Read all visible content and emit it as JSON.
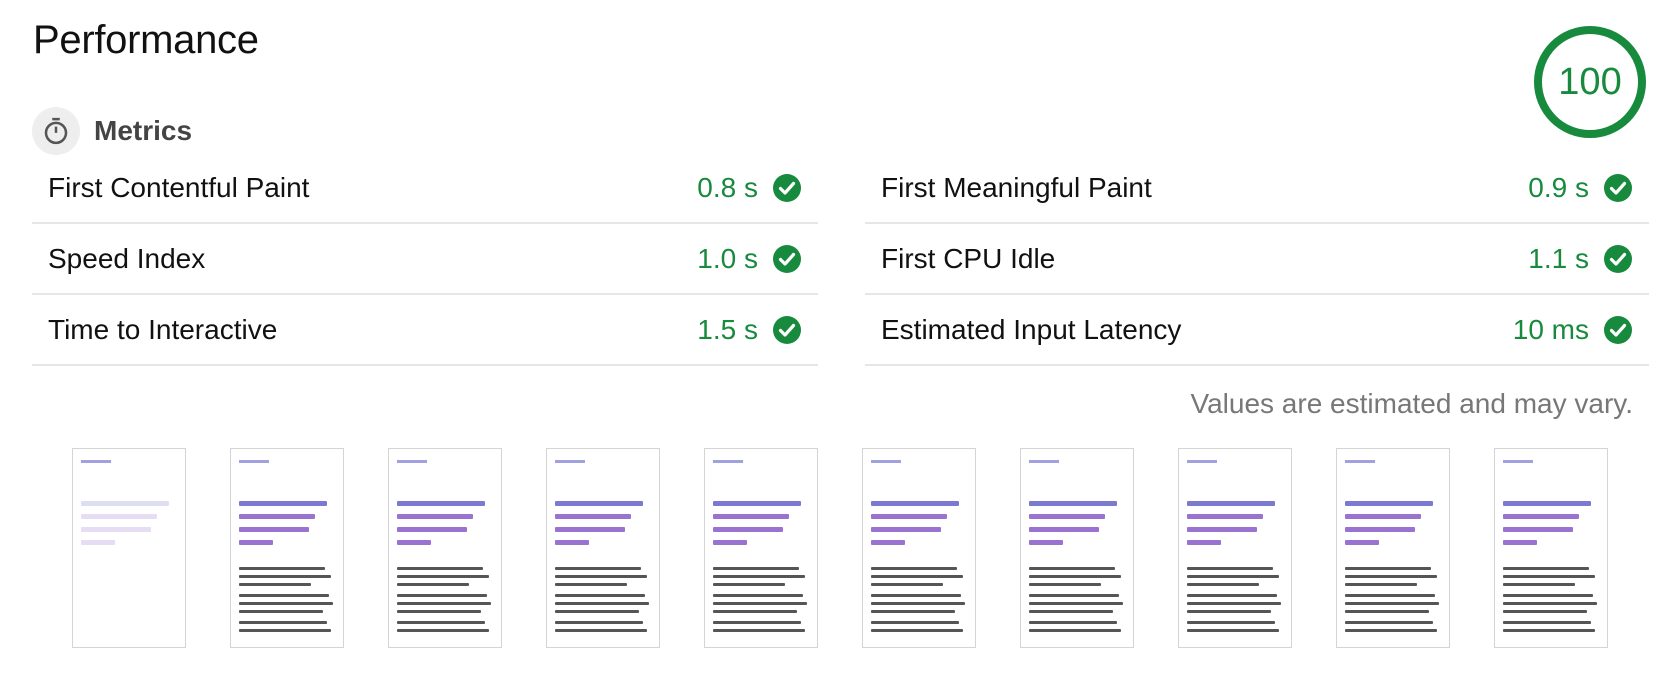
{
  "section": {
    "title": "Performance",
    "score": "100",
    "score_color": "#188a3e"
  },
  "metrics": {
    "header_label": "Metrics",
    "header_icon": "stopwatch-icon",
    "left": [
      {
        "label": "First Contentful Paint",
        "value": "0.8 s",
        "status": "pass"
      },
      {
        "label": "Speed Index",
        "value": "1.0 s",
        "status": "pass"
      },
      {
        "label": "Time to Interactive",
        "value": "1.5 s",
        "status": "pass"
      }
    ],
    "right": [
      {
        "label": "First Meaningful Paint",
        "value": "0.9 s",
        "status": "pass"
      },
      {
        "label": "First CPU Idle",
        "value": "1.1 s",
        "status": "pass"
      },
      {
        "label": "Estimated Input Latency",
        "value": "10 ms",
        "status": "pass"
      }
    ],
    "pass_color": "#188a3e",
    "note": "Values are estimated and may vary."
  },
  "filmstrip": {
    "frame_count": 10,
    "faded_frames": [
      0
    ]
  }
}
